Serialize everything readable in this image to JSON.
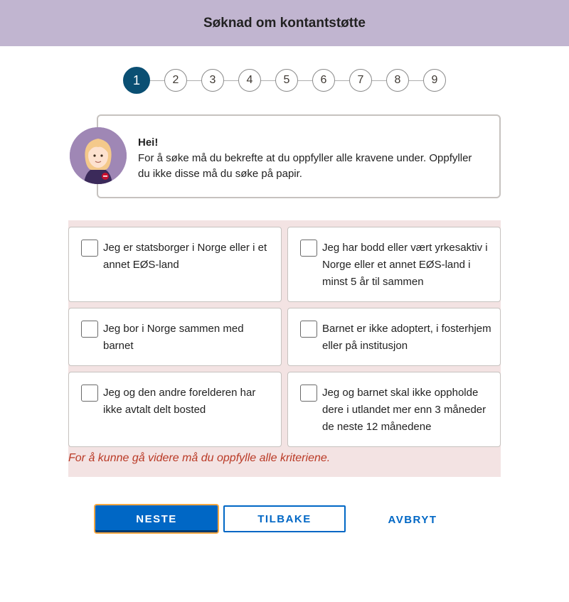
{
  "header": {
    "title": "Søknad om kontantstøtte"
  },
  "stepper": {
    "steps": [
      "1",
      "2",
      "3",
      "4",
      "5",
      "6",
      "7",
      "8",
      "9"
    ],
    "current": 1
  },
  "intro": {
    "greeting": "Hei!",
    "message": "For å søke må du bekrefte at du oppfyller alle kravene under. Oppfyller du ikke disse må du søke på papir."
  },
  "criteria": [
    {
      "label": "Jeg er statsborger i Norge eller i et annet EØS-land",
      "checked": false
    },
    {
      "label": "Jeg har bodd eller vært yrkesaktiv i Norge eller et annet EØS-land i minst 5 år til sammen",
      "checked": false
    },
    {
      "label": "Jeg bor i Norge sammen med barnet",
      "checked": false
    },
    {
      "label": "Barnet er ikke adoptert, i fosterhjem eller på institusjon",
      "checked": false
    },
    {
      "label": "Jeg og den andre forelderen har ikke avtalt delt bosted",
      "checked": false
    },
    {
      "label": "Jeg og barnet skal ikke oppholde dere i utlandet mer enn 3 måneder de neste 12 månedene",
      "checked": false
    }
  ],
  "error_message": "For å kunne gå videre må du oppfylle alle kriteriene.",
  "buttons": {
    "next": "NESTE",
    "back": "TILBAKE",
    "cancel": "AVBRYT"
  },
  "colors": {
    "header_bg": "#c1b5d0",
    "active_step": "#0a4f73",
    "primary": "#0067c5",
    "error_text": "#ba3a26",
    "error_panel": "#f3e3e3",
    "focus_outline": "#fba842"
  }
}
